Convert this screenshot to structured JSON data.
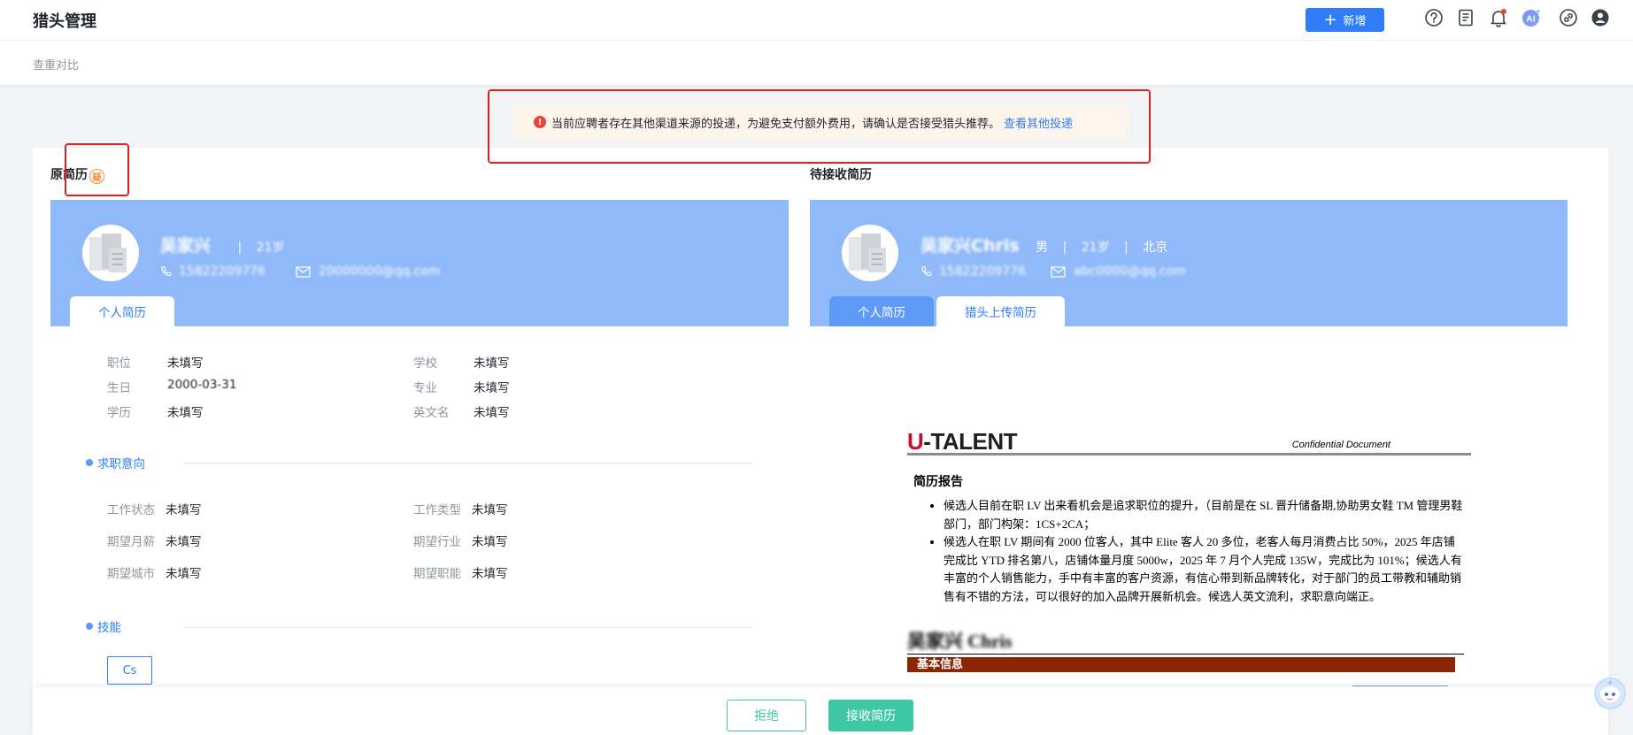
{
  "header": {
    "title": "猎头管理",
    "add_label": "新增",
    "ai_label": "AI",
    "icons": [
      "help-icon",
      "document-icon",
      "bell-icon",
      "ai-icon",
      "link-icon",
      "user-icon"
    ]
  },
  "breadcrumb": "查重对比",
  "notice": {
    "text": "当前应聘者存在其他渠道来源的投递，为避免支付额外费用，请确认是否接受猎头推荐。",
    "link": "查看其他投递"
  },
  "left": {
    "section_title": "原简历",
    "badge": "疑",
    "name": "吴家兴",
    "age": "21岁",
    "phone": "15822209776",
    "email": "20000000@qq.com",
    "tabs": [
      "个人简历"
    ],
    "fields": [
      {
        "label": "职位",
        "value": "未填写"
      },
      {
        "label": "学校",
        "value": "未填写"
      },
      {
        "label": "生日",
        "value": "2000-03-31"
      },
      {
        "label": "专业",
        "value": "未填写"
      },
      {
        "label": "学历",
        "value": "未填写"
      },
      {
        "label": "英文名",
        "value": "未填写"
      }
    ],
    "intent_title": "求职意向",
    "intent_fields": [
      {
        "label": "工作状态",
        "value": "未填写"
      },
      {
        "label": "工作类型",
        "value": "未填写"
      },
      {
        "label": "期望月薪",
        "value": "未填写"
      },
      {
        "label": "期望行业",
        "value": "未填写"
      },
      {
        "label": "期望城市",
        "value": "未填写"
      },
      {
        "label": "期望职能",
        "value": "未填写"
      }
    ],
    "skills_title": "技能",
    "skills": [
      "Cs"
    ]
  },
  "right": {
    "section_title": "待接收简历",
    "name": "吴家兴Chris",
    "gender": "男",
    "age": "21岁",
    "city": "北京",
    "phone": "15822209776",
    "email": "abc0000@qq.com",
    "tabs": [
      "个人简历",
      "猎头上传简历"
    ],
    "doc": {
      "logo_u": "U",
      "logo_rest": "-TALENT",
      "confidential": "Confidential Document",
      "report_title": "简历报告",
      "bullets": [
        "候选人目前在职 LV 出来看机会是追求职位的提升，（目前是在 SL 晋升储备期,协助男女鞋 TM 管理男鞋部门，部门构架：1CS+2CA；",
        "候选人在职 LV 期间有 2000 位客人，其中 Elite 客人 20 多位，老客人每月消费占比 50%，2025 年店铺完成比 YTD 排名第八，店铺体量月度 5000w，2025 年 7 月个人完成 135W，完成比为 101%；候选人有丰富的个人销售能力，手中有丰富的客户资源，有信心带到新品牌转化，对于部门的员工带教和辅助销售有不错的方法，可以很好的加入品牌开展新机会。候选人英文流利，求职意向端正。"
      ],
      "person_name": "吴家兴 Chris",
      "basic_info": "基本信息"
    }
  },
  "footer": {
    "reject": "拒绝",
    "accept": "接收简历"
  },
  "colors": {
    "primary": "#2f7df7",
    "head_bg": "#90b9f9",
    "accept": "#3fc8a6",
    "doc_bar": "#8b2500",
    "highlight": "#e02020"
  }
}
